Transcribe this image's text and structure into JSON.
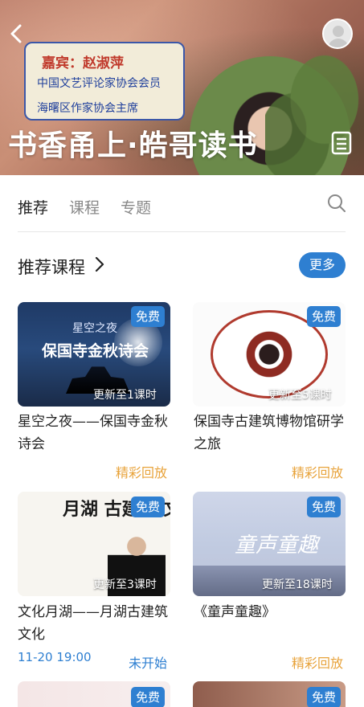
{
  "banner": {
    "guest_name": "嘉宾：赵淑萍",
    "guest_line1": "中国文艺评论家协会会员",
    "guest_line2": "海曙区作家协会主席",
    "title": "书香甬上·皓哥读书"
  },
  "tabs": [
    "推荐",
    "课程",
    "专题"
  ],
  "section": {
    "title": "推荐课程",
    "more": "更多"
  },
  "cards": [
    {
      "badge": "免费",
      "update": "更新至1课时",
      "title": "星空之夜——保国寺金秋诗会",
      "status": "精彩回放",
      "img_caption": "保国寺金秋诗会",
      "img_caption_top": "星空之夜"
    },
    {
      "badge": "免费",
      "update": "更新至5课时",
      "title": "保国寺古建筑博物馆研学之旅",
      "status": "精彩回放"
    },
    {
      "badge": "免费",
      "update": "更新至3课时",
      "title": "文化月湖——月湖古建筑文化",
      "time": "11-20 19:00",
      "status": "未开始",
      "img_chars": "月湖 古建 筑文化"
    },
    {
      "badge": "免费",
      "update": "更新至18课时",
      "title": "《童声童趣》",
      "status": "精彩回放",
      "img_calli": "童声童趣"
    },
    {
      "badge": "免费"
    },
    {
      "badge": "免费"
    }
  ],
  "colors": {
    "accent": "#2e7fd1",
    "replay": "#e8a33b"
  }
}
